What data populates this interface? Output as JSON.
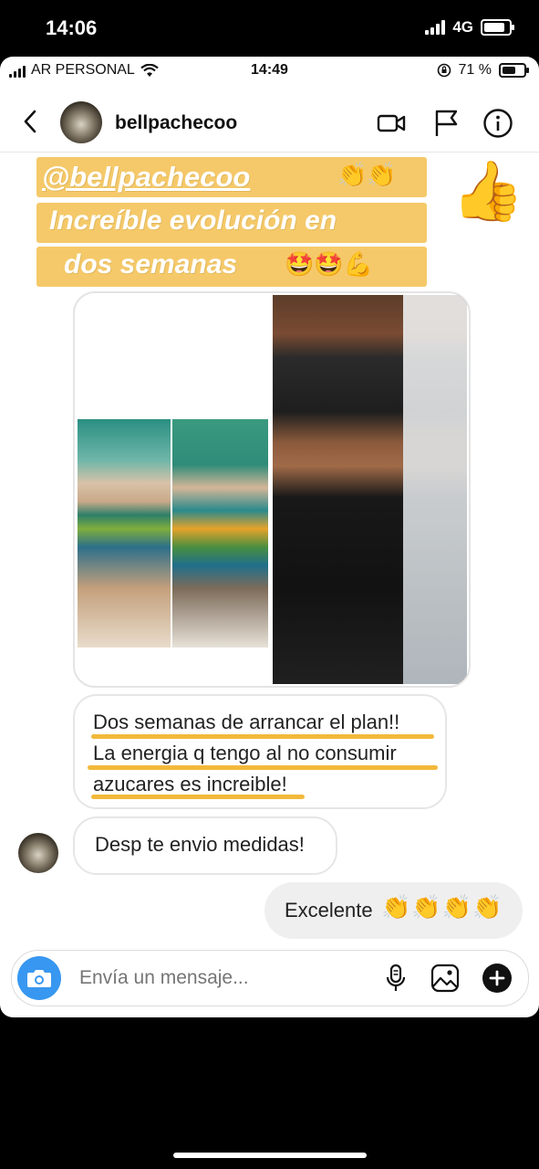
{
  "outer_status": {
    "time": "14:06",
    "network": "4G",
    "battery_level": 0.85
  },
  "inner_status": {
    "carrier": "AR PERSONAL",
    "time": "14:49",
    "battery": "71 %",
    "battery_level": 0.71
  },
  "header": {
    "username": "bellpachecoo",
    "icons": [
      "back-icon",
      "video-call-icon",
      "flag-icon",
      "info-icon"
    ]
  },
  "story": {
    "line1": "@bellpachecoo",
    "line1_emoji": "👏👏",
    "line2": "Increíble evolución en",
    "line3": "dos semanas",
    "line3_emoji": "🤩🤩💪",
    "thumb": "👍",
    "banner_color": "#f5c969"
  },
  "messages": {
    "received_1": {
      "line1": "Dos semanas de arrancar el plan!!",
      "line2": "La energia q tengo al no consumir",
      "line3": "azucares es increible!",
      "highlight_color": "#f2b93b"
    },
    "received_2": "Desp te envio medidas!",
    "sent_1": {
      "text": "Excelente",
      "emoji": "👏👏👏👏"
    }
  },
  "composer": {
    "placeholder": "Envía un mensaje...",
    "icons": [
      "camera-icon",
      "microphone-icon",
      "gallery-icon",
      "plus-icon"
    ]
  },
  "colors": {
    "accent": "#3897f0",
    "sent_bubble": "#efefef"
  }
}
